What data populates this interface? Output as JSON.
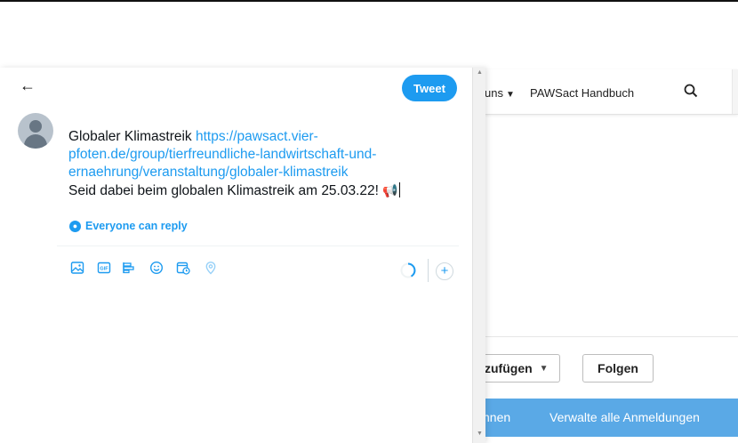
{
  "compose": {
    "tweet_button": "Tweet",
    "text_prefix": "Globaler Klimastreik ",
    "link_text": "https://pawsact.vier-pfoten.de/group/tierfreundliche-landwirtschaft-und-ernaehrung/veranstaltung/globaler-klimastreik",
    "text_line2": "Seid dabei beim globalen Klimastreik am 25.03.22! ",
    "emoji": "📢",
    "reply_setting": "Everyone can reply",
    "toolbar_icons": [
      "media-icon",
      "gif-icon",
      "poll-icon",
      "emoji-icon",
      "schedule-icon",
      "location-icon"
    ],
    "accent_color": "#1d9bf0"
  },
  "background_page": {
    "nav_partial": "uns",
    "nav_handbuch": "PAWSact Handbuch",
    "add_button_partial": "zufügen",
    "follow_button": "Folgen",
    "bluebar_partial": "nnen",
    "manage_link": "Verwalte alle Anmeldungen",
    "bluebar_color": "#5aa9e6"
  }
}
